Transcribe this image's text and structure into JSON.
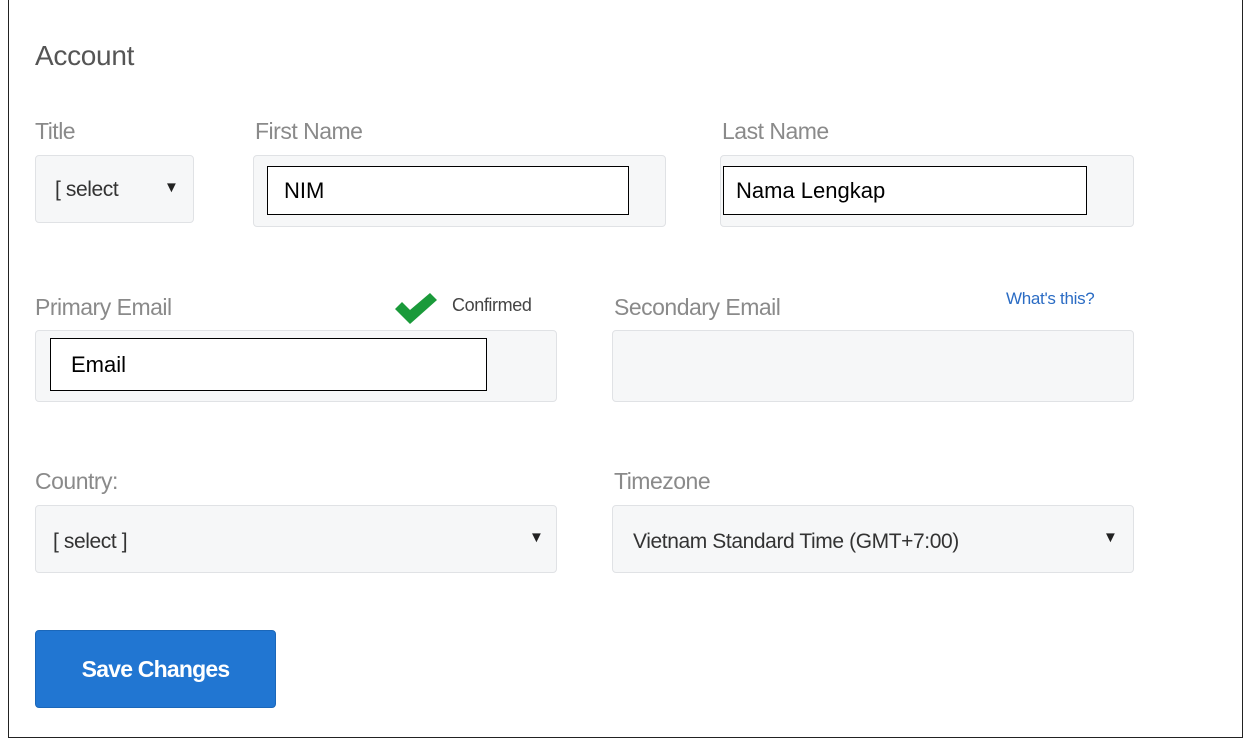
{
  "form": {
    "heading": "Account",
    "title": {
      "label": "Title",
      "value": "[ select"
    },
    "first_name": {
      "label": "First Name",
      "value": "NIM"
    },
    "last_name": {
      "label": "Last Name",
      "value": "Nama Lengkap"
    },
    "primary_email": {
      "label": "Primary Email",
      "value": "Email",
      "status": "Confirmed",
      "status_icon": "checkmark-icon"
    },
    "secondary_email": {
      "label": "Secondary Email",
      "value": "",
      "help_link": "What's this?"
    },
    "country": {
      "label": "Country:",
      "value": "[ select ]"
    },
    "timezone": {
      "label": "Timezone",
      "value": "Vietnam Standard Time (GMT+7:00)"
    },
    "save_label": "Save Changes"
  },
  "colors": {
    "accent": "#2176d2",
    "confirmed_check": "#1a9a3a",
    "link": "#2b6cc4"
  }
}
